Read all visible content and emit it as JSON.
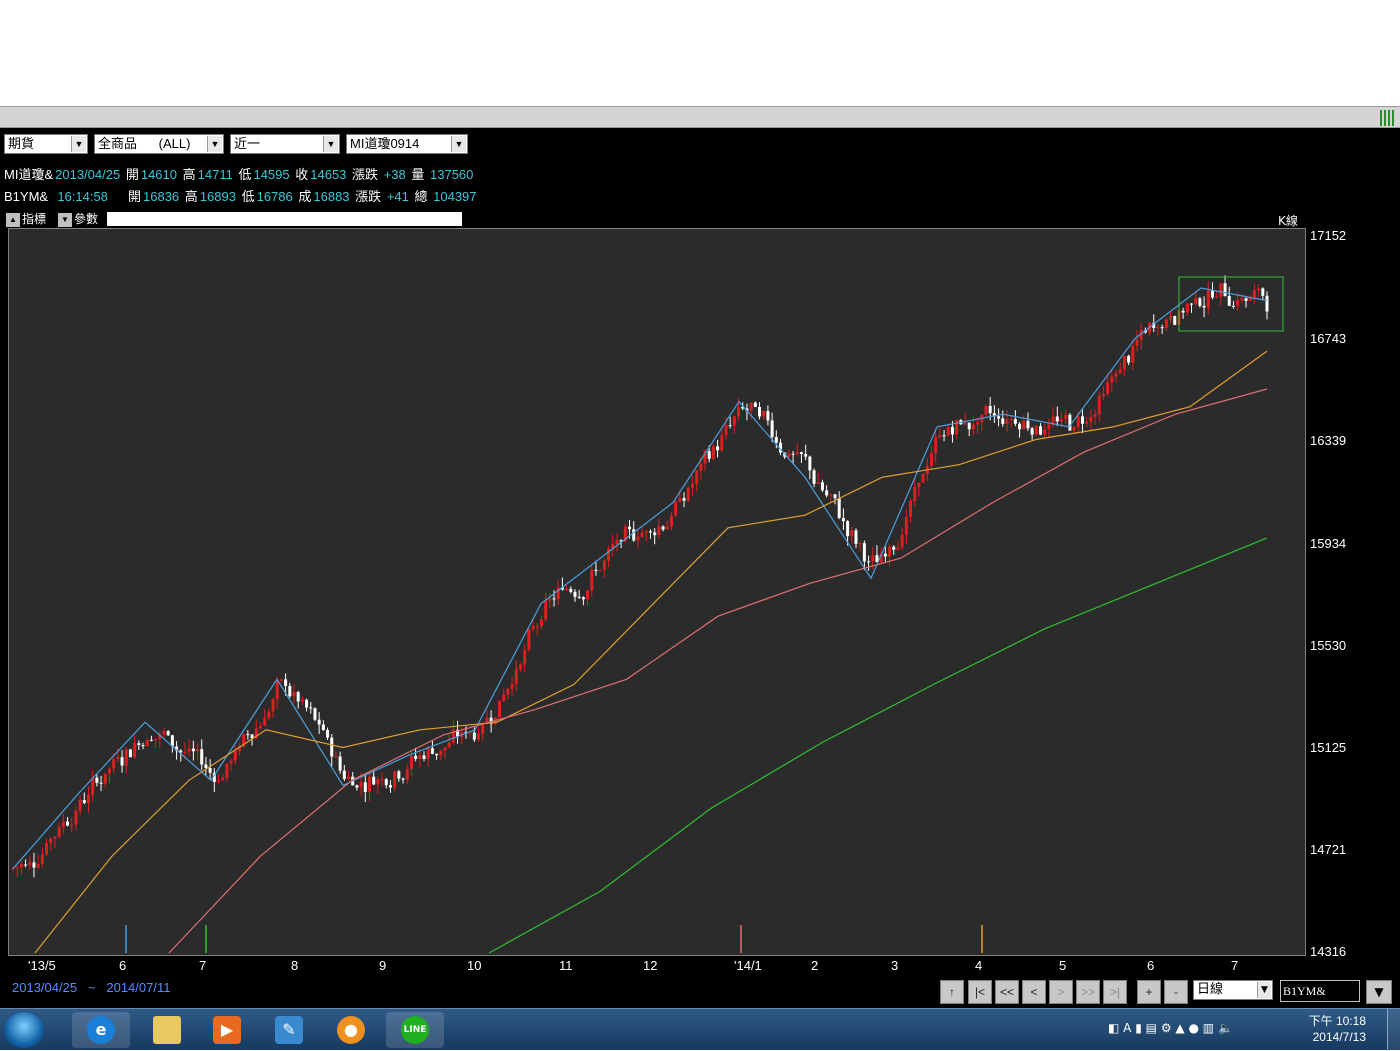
{
  "toolbar": {
    "market": "期貨",
    "product": "全商品      (ALL)",
    "month": "近一",
    "contract": "MI道瓊0914"
  },
  "quote1": {
    "symbol": "MI道瓊&",
    "date": "2013/04/25",
    "open_label": "開",
    "open": "14610",
    "high_label": "高",
    "high": "14711",
    "low_label": "低",
    "low": "14595",
    "close_label": "收",
    "close": "14653",
    "chg_label": "漲跌",
    "chg": "+38",
    "vol_label": "量",
    "vol": "137560"
  },
  "quote2": {
    "symbol": "B1YM&",
    "time": "16:14:58",
    "open_label": "開",
    "open": "16836",
    "high_label": "高",
    "high": "16893",
    "low_label": "低",
    "low": "16786",
    "close_label": "成",
    "close": "16883",
    "chg_label": "漲跌",
    "chg": "+41",
    "vol_label": "總",
    "vol": "104397"
  },
  "chart_toolbar": {
    "indicator": "指標",
    "params": "參數",
    "chart_type": "K線"
  },
  "chart_data": {
    "type": "candlestick",
    "y_ticks": [
      "17152",
      "16743",
      "16339",
      "15934",
      "15530",
      "15125",
      "14721",
      "14316"
    ],
    "ylim": [
      14316,
      17152
    ],
    "x_ticks": [
      "'13/5",
      "6",
      "7",
      "8",
      "9",
      "10",
      "11",
      "12",
      "'14/1",
      "2",
      "3",
      "4",
      "5",
      "6",
      "7"
    ],
    "moving_averages": [
      {
        "color": "#4aa0e0",
        "values": [
          14650,
          14950,
          15230,
          15000,
          15400,
          14980,
          15100,
          15200,
          15700,
          15900,
          16100,
          16500,
          16200,
          15800,
          16400,
          16450,
          16400,
          16750,
          16950,
          16900
        ]
      },
      {
        "color": "#e0a030",
        "values": [
          14316,
          14700,
          15000,
          15200,
          15130,
          15200,
          15230,
          15380,
          15690,
          16000,
          16050,
          16200,
          16250,
          16350,
          16400,
          16480,
          16700
        ]
      },
      {
        "color": "#e07070",
        "values": [
          14316,
          14700,
          15000,
          15180,
          15280,
          15400,
          15650,
          15780,
          15880,
          16100,
          16300,
          16450,
          16550
        ]
      },
      {
        "color": "#30c030",
        "values": [
          14316,
          14560,
          14890,
          15150,
          15380,
          15600,
          15780,
          15960
        ]
      }
    ],
    "volume_spikes": [
      {
        "x": "7",
        "color": "#30c030"
      },
      {
        "x": "'14/1",
        "color": "#e07070"
      },
      {
        "x": "4",
        "color": "#e0a030"
      },
      {
        "x": "6",
        "color": "#4aa0e0"
      }
    ]
  },
  "footer": {
    "date_start": "2013/04/25",
    "date_sep": "~",
    "date_end": "2014/07/11",
    "period": "日線",
    "symbol": "B1YM&"
  },
  "nav": [
    "↑",
    "|<",
    "<<",
    "<",
    ">",
    ">>",
    ">|",
    "+",
    "-"
  ],
  "taskbar": {
    "time": "下午 10:18",
    "date": "2014/7/13"
  },
  "colors": {
    "up": "#dd1f1f",
    "down": "#ffffff",
    "chart_bg": "#2b2b2b"
  }
}
